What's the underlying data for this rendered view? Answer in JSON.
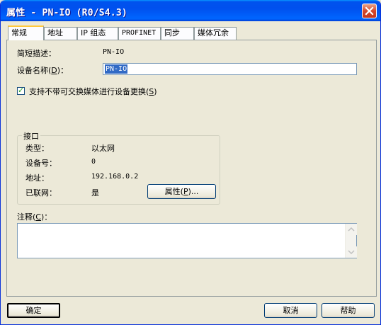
{
  "window": {
    "title": "属性 - PN-IO (R0/S4.3)"
  },
  "tabs": [
    {
      "label": "常规"
    },
    {
      "label": "地址"
    },
    {
      "label": "IP 组态"
    },
    {
      "label": "PROFINET"
    },
    {
      "label": "同步"
    },
    {
      "label": "媒体冗余"
    }
  ],
  "general": {
    "short_desc_label": "简短描述：",
    "short_desc_value": "PN-IO",
    "device_name_label": "设备名称(",
    "device_name_hotkey": "D",
    "device_name_label_end": ")：",
    "device_name_value": "PN-IO",
    "support_label": "支持不带可交换媒体进行设备更换(",
    "support_hotkey": "S",
    "support_label_end": ")",
    "support_checked": "✓"
  },
  "interface": {
    "group_title": "接口",
    "type_label": "类型：",
    "type_value": "以太网",
    "device_no_label": "设备号：",
    "device_no_value": "0",
    "address_label": "地址：",
    "address_value": "192.168.0.2",
    "networked_label": "已联网：",
    "networked_value": "是",
    "properties_button": "属性(",
    "properties_hotkey": "P",
    "properties_button_end": ")..."
  },
  "comment": {
    "label": "注释(",
    "hotkey": "C",
    "label_end": ")：",
    "value": ""
  },
  "buttons": {
    "ok": "确定",
    "cancel": "取消",
    "help": "帮助"
  },
  "colors": {
    "titlebar": "#0053ee",
    "close": "#d5472a",
    "tab_highlight": "#ffc83c",
    "selection": "#316ac5"
  }
}
